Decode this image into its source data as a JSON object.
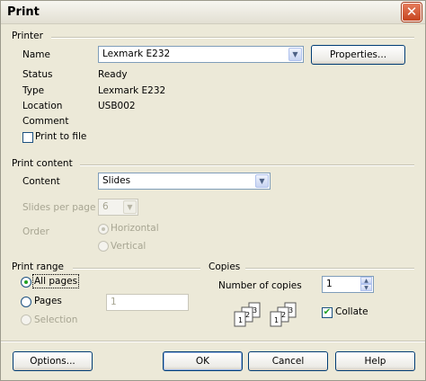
{
  "window": {
    "title": "Print"
  },
  "printer": {
    "section_label": "Printer",
    "name_label": "Name",
    "name_value": "Lexmark E232",
    "properties_label": "Properties...",
    "status_label": "Status",
    "status_value": "Ready",
    "type_label": "Type",
    "type_value": "Lexmark E232",
    "location_label": "Location",
    "location_value": "USB002",
    "comment_label": "Comment",
    "print_to_file_label": "Print to file"
  },
  "print_content": {
    "section_label": "Print content",
    "content_label": "Content",
    "content_value": "Slides",
    "slides_per_page_label": "Slides per page",
    "slides_per_page_value": "6",
    "order_label": "Order",
    "order_horizontal": "Horizontal",
    "order_vertical": "Vertical"
  },
  "print_range": {
    "section_label": "Print range",
    "all_pages": "All pages",
    "pages": "Pages",
    "pages_value": "1",
    "selection": "Selection"
  },
  "copies": {
    "section_label": "Copies",
    "number_label": "Number of copies",
    "number_value": "1",
    "collate_label": "Collate",
    "collate_icon_a": [
      "1",
      "2",
      "3"
    ],
    "collate_icon_b": [
      "1",
      "2",
      "3"
    ]
  },
  "buttons": {
    "options": "Options...",
    "ok": "OK",
    "cancel": "Cancel",
    "help": "Help"
  },
  "colors": {
    "dialog_bg": "#ece9d8",
    "button_border": "#003c74",
    "check_green": "#21a121",
    "close_red": "#c6451f"
  }
}
